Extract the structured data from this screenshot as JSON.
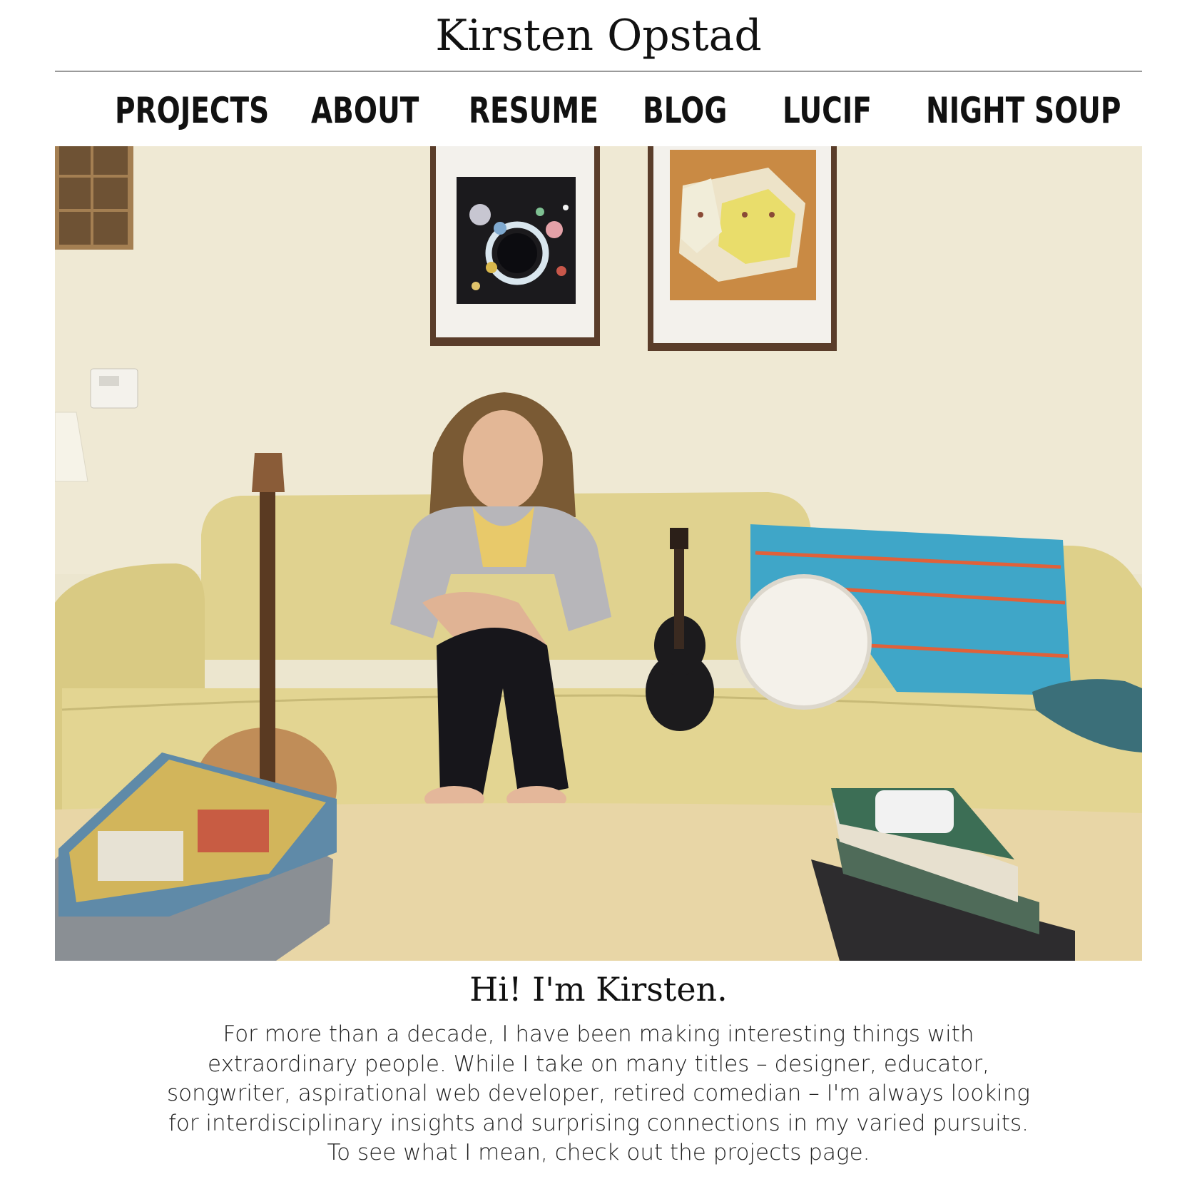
{
  "site": {
    "title": "Kirsten Opstad"
  },
  "nav": {
    "items": [
      {
        "label": "PROJECTS"
      },
      {
        "label": "ABOUT"
      },
      {
        "label": "RESUME"
      },
      {
        "label": "BLOG"
      },
      {
        "label": "LUCIF"
      },
      {
        "label": "NIGHT SOUP"
      }
    ]
  },
  "hero": {
    "image": "hero-photo",
    "colors": {
      "wall": "#ece6cf",
      "sofa": "#e1d38f",
      "ottoman": "#e8d6a6",
      "blanket": "#3fa6c8",
      "blanket_stripe": "#e0613a"
    }
  },
  "intro": {
    "heading": "Hi! I'm Kirsten.",
    "body": "For more than a decade, I have been making interesting things with extraordinary people. While I take on many titles – designer, educator, songwriter, aspirational web developer, retired comedian – I'm always looking for interdisciplinary insights and surprising connections in my varied pursuits. To see what I mean, check out the projects page."
  }
}
